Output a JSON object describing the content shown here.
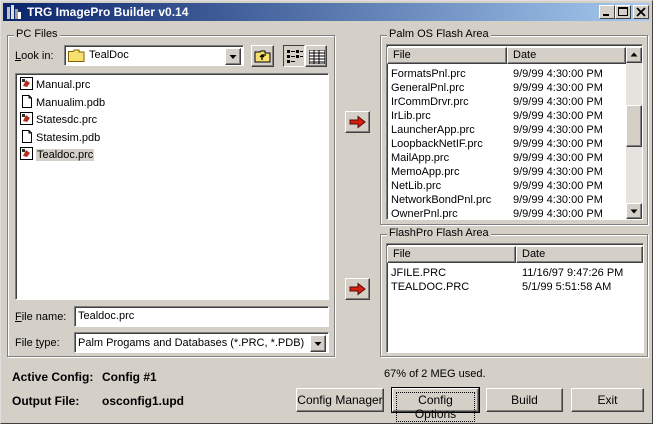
{
  "window": {
    "title": "TRG ImagePro Builder v0.14",
    "controls": [
      "minimize",
      "maximize",
      "close"
    ]
  },
  "pc_files": {
    "group_label": "PC Files",
    "look_in_label": "Look in:",
    "look_in_value": "TealDoc",
    "files": [
      {
        "name": "Manual.prc",
        "icon": "prc-file-icon"
      },
      {
        "name": "Manualim.pdb",
        "icon": "pdb-file-icon"
      },
      {
        "name": "Statesdc.prc",
        "icon": "prc-file-icon"
      },
      {
        "name": "Statesim.pdb",
        "icon": "pdb-file-icon"
      },
      {
        "name": "Tealdoc.prc",
        "icon": "prc-file-icon",
        "selected": true
      }
    ],
    "file_name_label": "File name:",
    "file_name_value": "Tealdoc.prc",
    "file_type_label": "File type:",
    "file_type_value": "Palm Progams and Databases (*.PRC, *.PDB)"
  },
  "palm_flash": {
    "group_label": "Palm OS Flash Area",
    "col_file": "File",
    "col_date": "Date",
    "rows": [
      {
        "file": "FormatsPnl.prc",
        "date": "9/9/99 4:30:00 PM"
      },
      {
        "file": "GeneralPnl.prc",
        "date": "9/9/99 4:30:00 PM"
      },
      {
        "file": "IrCommDrvr.prc",
        "date": "9/9/99 4:30:00 PM"
      },
      {
        "file": "IrLib.prc",
        "date": "9/9/99 4:30:00 PM"
      },
      {
        "file": "LauncherApp.prc",
        "date": "9/9/99 4:30:00 PM"
      },
      {
        "file": "LoopbackNetIF.prc",
        "date": "9/9/99 4:30:00 PM"
      },
      {
        "file": "MailApp.prc",
        "date": "9/9/99 4:30:00 PM"
      },
      {
        "file": "MemoApp.prc",
        "date": "9/9/99 4:30:00 PM"
      },
      {
        "file": "NetLib.prc",
        "date": "9/9/99 4:30:00 PM"
      },
      {
        "file": "NetworkBondPnl.prc",
        "date": "9/9/99 4:30:00 PM"
      },
      {
        "file": "OwnerPnl.prc",
        "date": "9/9/99 4:30:00 PM"
      }
    ]
  },
  "flashpro": {
    "group_label": "FlashPro Flash Area",
    "col_file": "File",
    "col_date": "Date",
    "rows": [
      {
        "file": "JFILE.PRC",
        "date": "11/16/97 9:47:26 PM"
      },
      {
        "file": "TEALDOC.PRC",
        "date": "5/1/99 5:51:58 AM"
      }
    ]
  },
  "status": {
    "usage": "67% of 2 MEG used.",
    "active_config_label": "Active Config:",
    "active_config_value": "Config #1",
    "output_file_label": "Output File:",
    "output_file_value": "osconfig1.upd"
  },
  "buttons": {
    "config_manager": "Config Manager",
    "config_options": "Config Options",
    "build": "Build",
    "exit": "Exit"
  },
  "colors": {
    "title_start": "#0a246a",
    "title_end": "#a6caf0",
    "arrow": "#d42010",
    "face": "#d4d0c8"
  }
}
